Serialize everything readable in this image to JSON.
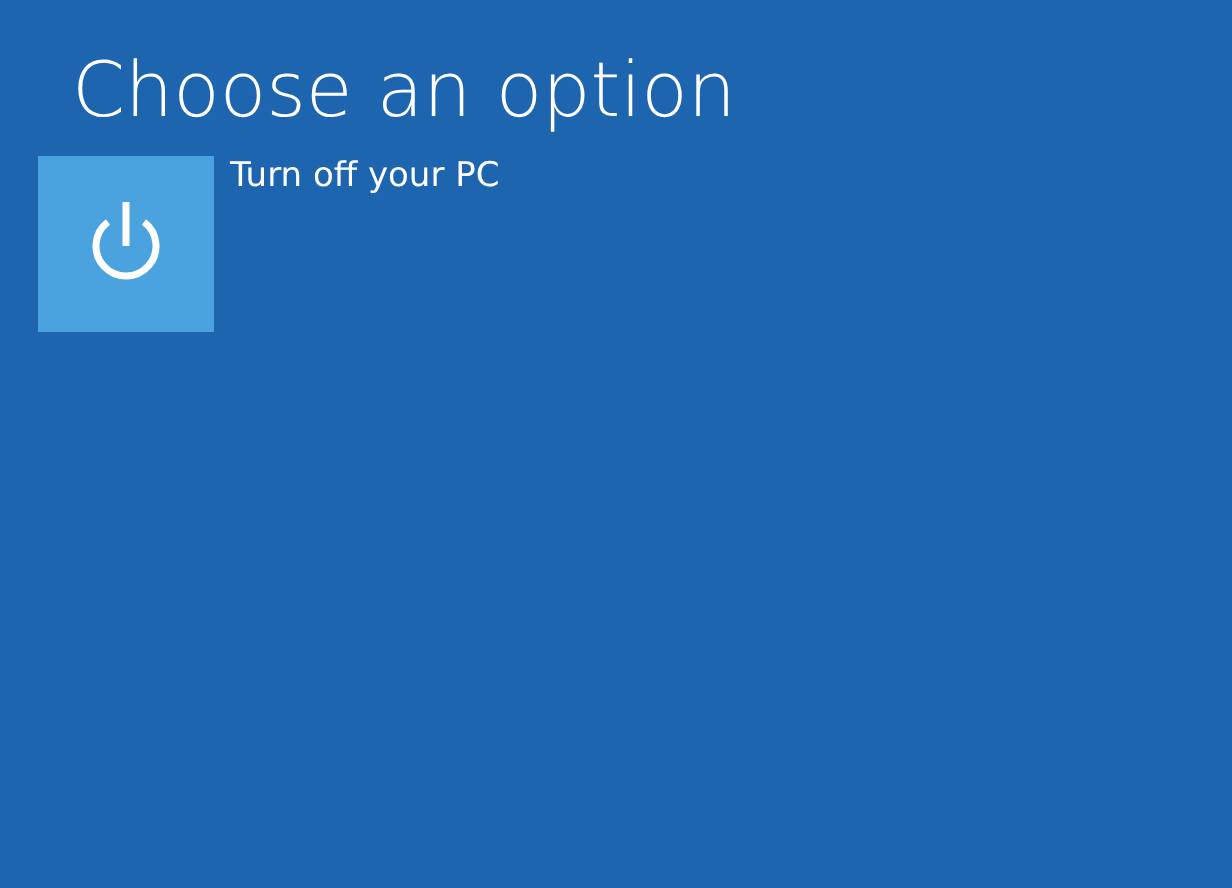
{
  "title": "Choose an option",
  "options": [
    {
      "kind": "power",
      "label": "Turn off your PC"
    }
  ]
}
